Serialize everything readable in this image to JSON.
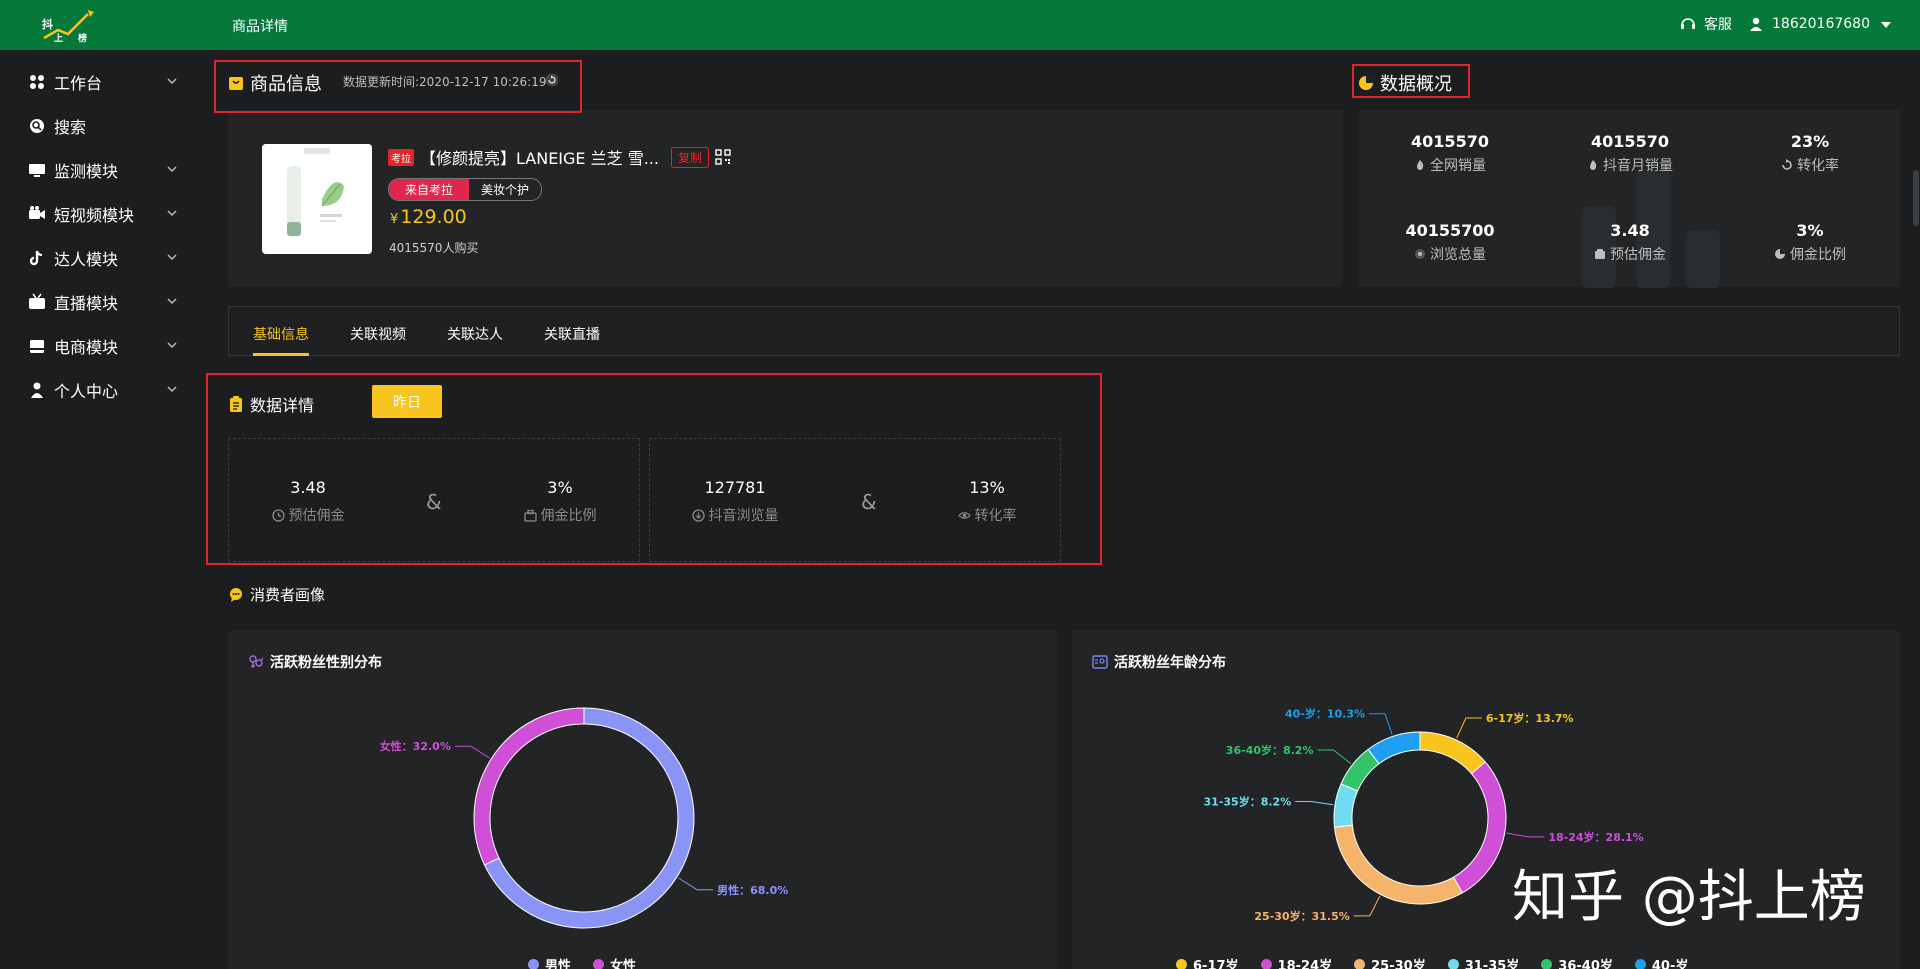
{
  "header": {
    "logo_text": "抖上榜",
    "page_title": "商品详情",
    "service_label": "客服",
    "user_phone": "18620167680"
  },
  "sidebar": {
    "items": [
      {
        "label": "工作台",
        "icon": "grid-icon",
        "has_chevron": true
      },
      {
        "label": "搜索",
        "icon": "search-icon",
        "has_chevron": false
      },
      {
        "label": "监测模块",
        "icon": "monitor-icon",
        "has_chevron": true
      },
      {
        "label": "短视频模块",
        "icon": "video-camera-icon",
        "has_chevron": true
      },
      {
        "label": "达人模块",
        "icon": "tiktok-icon",
        "has_chevron": true
      },
      {
        "label": "直播模块",
        "icon": "tv-icon",
        "has_chevron": true
      },
      {
        "label": "电商模块",
        "icon": "shop-icon",
        "has_chevron": true
      },
      {
        "label": "个人中心",
        "icon": "user-icon",
        "has_chevron": true
      }
    ]
  },
  "product_info": {
    "title": "商品信息",
    "update_label": "数据更新时间:2020-12-17 10:26:19",
    "source_tag": "考拉",
    "name": "【修颜提亮】LANEIGE 兰芝 雪...",
    "copy_label": "复制",
    "origin_pill": "来自考拉",
    "category_pill": "美妆个护",
    "currency": "¥",
    "price": "129.00",
    "buyers": "4015570人购买"
  },
  "overview": {
    "title": "数据概况",
    "metrics": [
      {
        "value": "4015570",
        "label": "全网销量",
        "icon": "fire-icon"
      },
      {
        "value": "4015570",
        "label": "抖音月销量",
        "icon": "fire-icon"
      },
      {
        "value": "23%",
        "label": "转化率",
        "icon": "refresh-icon"
      },
      {
        "value": "40155700",
        "label": "浏览总量",
        "icon": "eye-icon"
      },
      {
        "value": "3.48",
        "label": "预估佣金",
        "icon": "wallet-icon"
      },
      {
        "value": "3%",
        "label": "佣金比例",
        "icon": "pie-icon"
      }
    ]
  },
  "tabs": [
    {
      "label": "基础信息",
      "active": true
    },
    {
      "label": "关联视频",
      "active": false
    },
    {
      "label": "关联达人",
      "active": false
    },
    {
      "label": "关联直播",
      "active": false
    }
  ],
  "data_detail": {
    "title": "数据详情",
    "period_button": "昨日",
    "amp": "&",
    "groups": [
      [
        {
          "value": "3.48",
          "label": "预估佣金",
          "icon": "clock-icon"
        },
        {
          "value": "3%",
          "label": "佣金比例",
          "icon": "briefcase-icon"
        }
      ],
      [
        {
          "value": "127781",
          "label": "抖音浏览量",
          "icon": "download-circle-icon"
        },
        {
          "value": "13%",
          "label": "转化率",
          "icon": "eye-icon"
        }
      ]
    ]
  },
  "consumer": {
    "title": "消费者画像",
    "gender_chart": {
      "title": "活跃粉丝性别分布",
      "slice_labels": [
        "男性：68.0%",
        "女性：32.0%"
      ]
    },
    "age_chart": {
      "title": "活跃粉丝年龄分布",
      "slice_labels": [
        "6-17岁：13.7%",
        "18-24岁：28.1%",
        "25-30岁：31.5%",
        "31-35岁：8.2%",
        "36-40岁：8.2%",
        "40-岁：10.3%"
      ]
    }
  },
  "chart_data": [
    {
      "type": "pie",
      "title": "活跃粉丝性别分布",
      "categories": [
        "男性",
        "女性"
      ],
      "values": [
        68.0,
        32.0
      ],
      "colors": [
        "#8a94f7",
        "#cf4fd6"
      ],
      "legend": "bottom"
    },
    {
      "type": "pie",
      "title": "活跃粉丝年龄分布",
      "categories": [
        "6-17岁",
        "18-24岁",
        "25-30岁",
        "31-35岁",
        "36-40岁",
        "40-岁"
      ],
      "values": [
        13.7,
        28.1,
        31.5,
        8.2,
        8.2,
        10.3
      ],
      "colors": [
        "#f7c51e",
        "#cf4fd6",
        "#f5b46a",
        "#6fdcf2",
        "#33c46a",
        "#1e9ff2"
      ],
      "legend": "bottom"
    }
  ],
  "watermark": "知乎 @抖上榜"
}
